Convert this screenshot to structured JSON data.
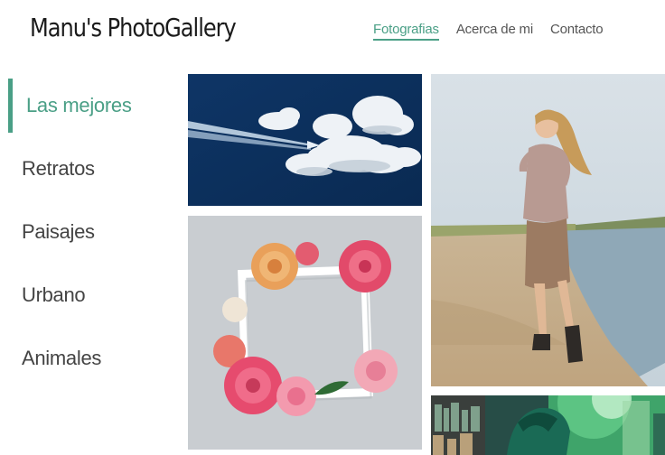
{
  "header": {
    "brand": "Manu's PhotoGallery",
    "nav": [
      {
        "label": "Fotografias",
        "active": true
      },
      {
        "label": "Acerca de mi",
        "active": false
      },
      {
        "label": "Contacto",
        "active": false
      }
    ]
  },
  "sidebar": {
    "items": [
      {
        "label": "Las mejores",
        "active": true
      },
      {
        "label": "Retratos",
        "active": false
      },
      {
        "label": "Paisajes",
        "active": false
      },
      {
        "label": "Urbano",
        "active": false
      },
      {
        "label": "Animales",
        "active": false
      }
    ]
  },
  "colors": {
    "accent": "#4a9f86"
  }
}
